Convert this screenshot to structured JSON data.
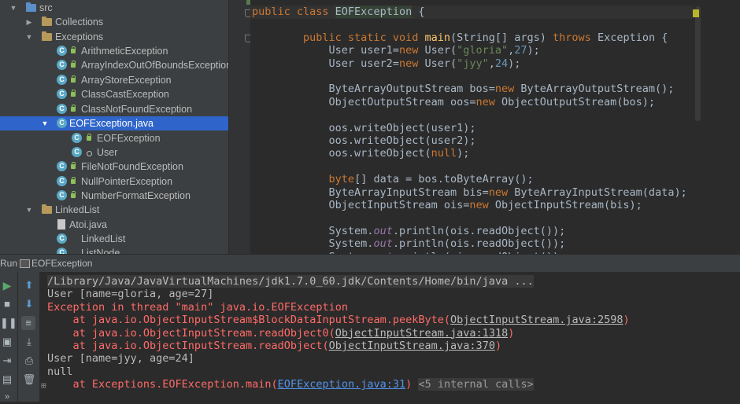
{
  "tree": {
    "root": "src",
    "items": [
      {
        "label": "Collections"
      },
      {
        "label": "Exceptions"
      },
      {
        "label": "ArithmeticException"
      },
      {
        "label": "ArrayIndexOutOfBoundsException"
      },
      {
        "label": "ArrayStoreException"
      },
      {
        "label": "ClassCastException"
      },
      {
        "label": "ClassNotFoundException"
      },
      {
        "label": "EOFException.java"
      },
      {
        "label": "EOFException"
      },
      {
        "label": "User"
      },
      {
        "label": "FileNotFoundException"
      },
      {
        "label": "NullPointerException"
      },
      {
        "label": "NumberFormatException"
      },
      {
        "label": "LinkedList"
      },
      {
        "label": "Atoi.java"
      },
      {
        "label": "LinkedList"
      },
      {
        "label": "ListNode"
      }
    ]
  },
  "editor": {
    "lines": [
      {
        "parts": [
          [
            "kw",
            "public class "
          ],
          [
            "hi",
            "EOFException"
          ],
          [
            "t",
            " {"
          ]
        ]
      },
      {
        "parts": []
      },
      {
        "parts": [
          [
            "t",
            "        "
          ],
          [
            "kw",
            "public static void "
          ],
          [
            "fn",
            "main"
          ],
          [
            "t",
            "(String[] args) "
          ],
          [
            "kw",
            "throws "
          ],
          [
            "t",
            "Exception {"
          ]
        ]
      },
      {
        "parts": [
          [
            "t",
            "            User user1="
          ],
          [
            "kw",
            "new "
          ],
          [
            "t",
            "User("
          ],
          [
            "str",
            "\"gloria\""
          ],
          [
            "t",
            ","
          ],
          [
            "num",
            "27"
          ],
          [
            "t",
            ");"
          ]
        ]
      },
      {
        "parts": [
          [
            "t",
            "            User user2="
          ],
          [
            "kw",
            "new "
          ],
          [
            "t",
            "User("
          ],
          [
            "str",
            "\"jyy\""
          ],
          [
            "t",
            ","
          ],
          [
            "num",
            "24"
          ],
          [
            "t",
            ");"
          ]
        ]
      },
      {
        "parts": []
      },
      {
        "parts": [
          [
            "t",
            "            ByteArrayOutputStream bos="
          ],
          [
            "kw",
            "new "
          ],
          [
            "t",
            "ByteArrayOutputStream();"
          ]
        ]
      },
      {
        "parts": [
          [
            "t",
            "            ObjectOutputStream oos="
          ],
          [
            "kw",
            "new "
          ],
          [
            "t",
            "ObjectOutputStream(bos);"
          ]
        ]
      },
      {
        "parts": []
      },
      {
        "parts": [
          [
            "t",
            "            oos.writeObject(user1);"
          ]
        ]
      },
      {
        "parts": [
          [
            "t",
            "            oos.writeObject(user2);"
          ]
        ]
      },
      {
        "parts": [
          [
            "t",
            "            oos.writeObject("
          ],
          [
            "kw",
            "null"
          ],
          [
            "t",
            ");"
          ]
        ]
      },
      {
        "parts": []
      },
      {
        "parts": [
          [
            "t",
            "            "
          ],
          [
            "kw",
            "byte"
          ],
          [
            "t",
            "[] data = bos.toByteArray();"
          ]
        ]
      },
      {
        "parts": [
          [
            "t",
            "            ByteArrayInputStream bis="
          ],
          [
            "kw",
            "new "
          ],
          [
            "t",
            "ByteArrayInputStream(data);"
          ]
        ]
      },
      {
        "parts": [
          [
            "t",
            "            ObjectInputStream ois="
          ],
          [
            "kw",
            "new "
          ],
          [
            "t",
            "ObjectInputStream(bis);"
          ]
        ]
      },
      {
        "parts": []
      },
      {
        "parts": [
          [
            "t",
            "            System."
          ],
          [
            "fld",
            "out"
          ],
          [
            "t",
            ".println(ois.readObject());"
          ]
        ]
      },
      {
        "parts": [
          [
            "t",
            "            System."
          ],
          [
            "fld",
            "out"
          ],
          [
            "t",
            ".println(ois.readObject());"
          ]
        ]
      },
      {
        "parts": [
          [
            "t",
            "            System."
          ],
          [
            "fld",
            "out"
          ],
          [
            "t",
            ".println(ois.readObject());"
          ]
        ]
      }
    ]
  },
  "run": {
    "label": "Run",
    "config": "EOFException"
  },
  "console": {
    "lines": [
      {
        "parts": [
          [
            "cmd",
            "/Library/Java/JavaVirtualMachines/jdk1.7.0_60.jdk/Contents/Home/bin/java ..."
          ]
        ]
      },
      {
        "parts": [
          [
            "t",
            "User [name=gloria, age=27]"
          ]
        ]
      },
      {
        "parts": [
          [
            "err",
            "Exception in thread \"main\" java.io.EOFException"
          ]
        ]
      },
      {
        "parts": [
          [
            "err",
            "    at java.io.ObjectInputStream$BlockDataInputStream.peekByte("
          ],
          [
            "elink",
            "ObjectInputStream.java:2598"
          ],
          [
            "err",
            ")"
          ]
        ]
      },
      {
        "parts": [
          [
            "err",
            "    at java.io.ObjectInputStream.readObject0("
          ],
          [
            "elink",
            "ObjectInputStream.java:1318"
          ],
          [
            "err",
            ")"
          ]
        ]
      },
      {
        "parts": [
          [
            "err",
            "    at java.io.ObjectInputStream.readObject("
          ],
          [
            "elink",
            "ObjectInputStream.java:370"
          ],
          [
            "err",
            ")"
          ]
        ]
      },
      {
        "parts": [
          [
            "t",
            "User [name=jyy, age=24]"
          ]
        ]
      },
      {
        "parts": [
          [
            "t",
            "null"
          ]
        ]
      },
      {
        "parts": [
          [
            "err",
            "    at Exceptions.EOFException.main("
          ],
          [
            "link",
            "EOFException.java:31"
          ],
          [
            "err",
            ") "
          ],
          [
            "grey",
            "<5 internal calls>"
          ]
        ]
      }
    ]
  }
}
